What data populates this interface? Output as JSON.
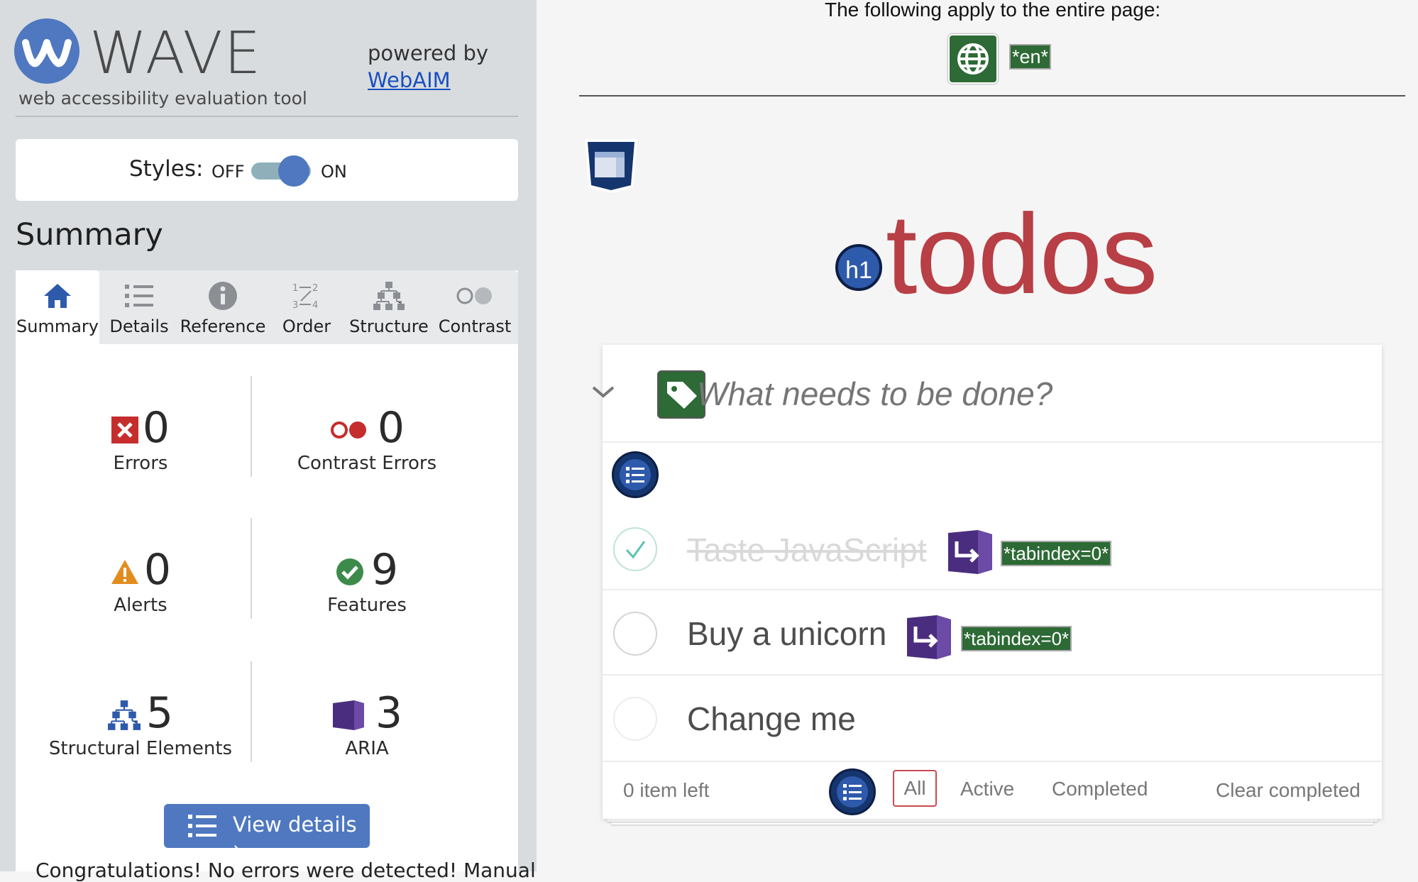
{
  "sidebar": {
    "logo_title": "WAVE",
    "logo_subtitle": "web accessibility evaluation tool",
    "powered_by": "powered by",
    "webaim_link": "WebAIM",
    "styles": {
      "label": "Styles:",
      "off": "OFF",
      "on": "ON",
      "state": "on"
    },
    "summary_heading": "Summary",
    "tabs": [
      {
        "label": "Summary",
        "icon": "home-icon",
        "active": true
      },
      {
        "label": "Details",
        "icon": "list-icon",
        "active": false
      },
      {
        "label": "Reference",
        "icon": "info-icon",
        "active": false
      },
      {
        "label": "Order",
        "icon": "order-icon",
        "active": false
      },
      {
        "label": "Structure",
        "icon": "structure-icon",
        "active": false
      },
      {
        "label": "Contrast",
        "icon": "contrast-icon",
        "active": false
      }
    ],
    "stats": {
      "errors": {
        "count": "0",
        "label": "Errors"
      },
      "contrast_errors": {
        "count": "0",
        "label": "Contrast Errors"
      },
      "alerts": {
        "count": "0",
        "label": "Alerts"
      },
      "features": {
        "count": "9",
        "label": "Features"
      },
      "structural": {
        "count": "5",
        "label": "Structural Elements"
      },
      "aria": {
        "count": "3",
        "label": "ARIA"
      }
    },
    "view_details": "View details ›",
    "footer_text": "Congratulations! No errors were detected! Manual"
  },
  "page": {
    "doc_notice": "The following apply to the entire page:",
    "lang_tag": "*en*",
    "h1_badge": "h1",
    "title": "todos",
    "new_todo_placeholder": "What needs to be done?",
    "tabindex_tag": "*tabindex=0*",
    "items": [
      {
        "text": "Taste JavaScript",
        "completed": true
      },
      {
        "text": "Buy a unicorn",
        "completed": false
      },
      {
        "text": "Change me",
        "completed": false
      }
    ],
    "footer": {
      "count": "0 item left",
      "filters": [
        "All",
        "Active",
        "Completed"
      ],
      "selected_filter": "All",
      "clear": "Clear completed"
    }
  },
  "colors": {
    "wave_blue": "#4f78c0",
    "todo_red": "#b83f45",
    "tag_green": "#2d6a35",
    "aria_purple": "#4a2d7e",
    "error_red": "#c62d2d",
    "success_green": "#3d8b4a",
    "alert_orange": "#e38c1e"
  }
}
